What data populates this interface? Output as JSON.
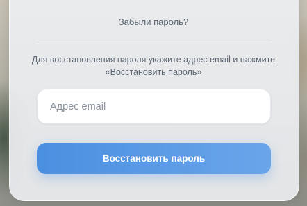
{
  "form": {
    "forgot_password_link": "Забыли пароль?",
    "hint": "Для восстановления пароля укажите адрес email и нажмите «Восстановить пароль»",
    "email_placeholder": "Адрес email",
    "email_value": "",
    "submit_label": "Восстановить пароль"
  },
  "colors": {
    "accent": "#4a8fe0",
    "text_muted": "#5b6470"
  }
}
